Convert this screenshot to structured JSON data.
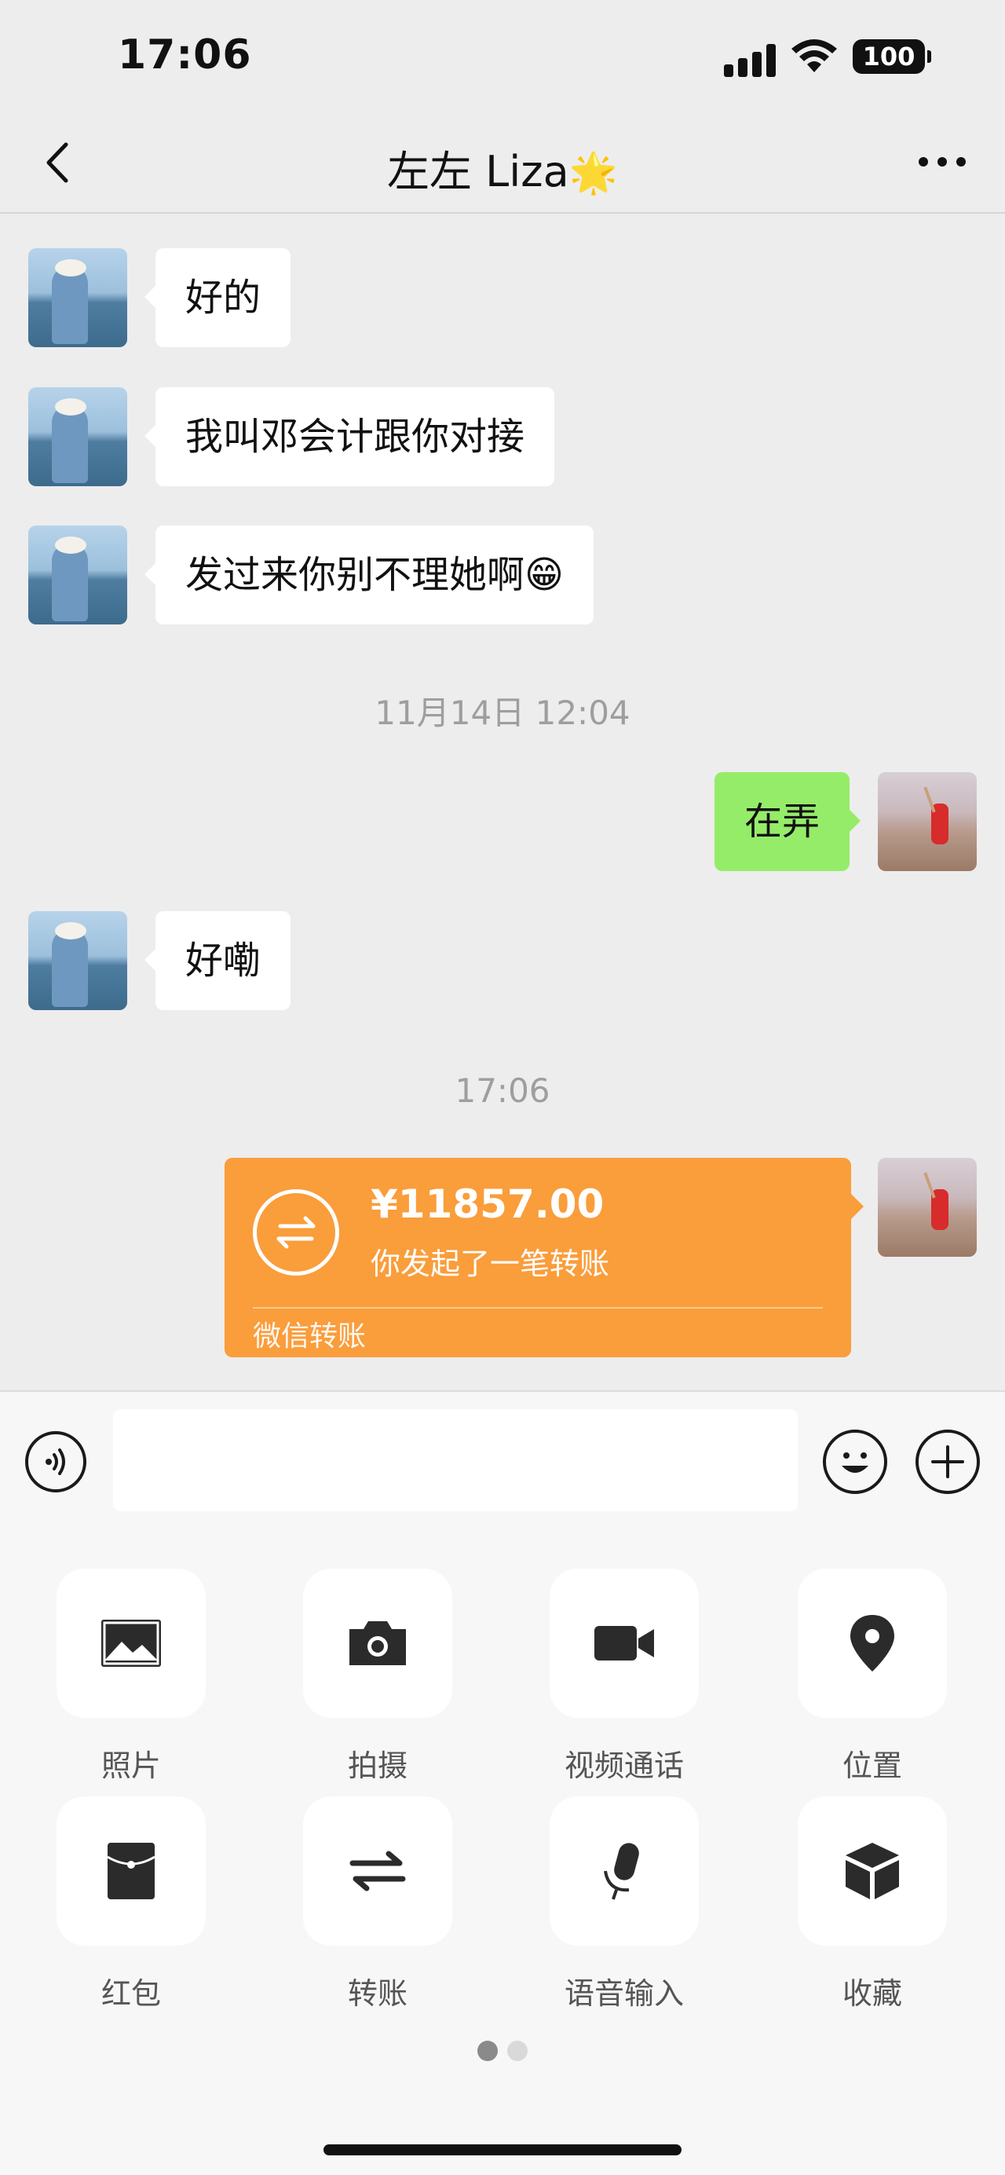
{
  "status_bar": {
    "time": "17:06",
    "battery": "100"
  },
  "nav": {
    "title": "左左 Liza",
    "title_emoji": "🌟"
  },
  "messages": [
    {
      "text": "好的"
    },
    {
      "text": "我叫邓会计跟你对接"
    },
    {
      "text": "发过来你别不理她啊😁"
    },
    {
      "timestamp": "11月14日 12:04"
    },
    {
      "text": "在弄"
    },
    {
      "text": "好嘞"
    },
    {
      "timestamp": "17:06"
    }
  ],
  "transfer": {
    "amount": "¥11857.00",
    "description": "你发起了一笔转账",
    "footer": "微信转账"
  },
  "input": {
    "value": ""
  },
  "tools": [
    {
      "label": "照片",
      "icon": "image-icon"
    },
    {
      "label": "拍摄",
      "icon": "camera-icon"
    },
    {
      "label": "视频通话",
      "icon": "video-camera-icon"
    },
    {
      "label": "位置",
      "icon": "location-pin-icon"
    },
    {
      "label": "红包",
      "icon": "red-packet-icon"
    },
    {
      "label": "转账",
      "icon": "transfer-arrows-icon"
    },
    {
      "label": "语音输入",
      "icon": "microphone-icon"
    },
    {
      "label": "收藏",
      "icon": "cube-icon"
    }
  ],
  "colors": {
    "outgoing_bubble": "#95ec69",
    "transfer_card": "#fa9d3b",
    "background": "#ededed"
  },
  "panel_pages": {
    "count": 2,
    "active": 0
  }
}
